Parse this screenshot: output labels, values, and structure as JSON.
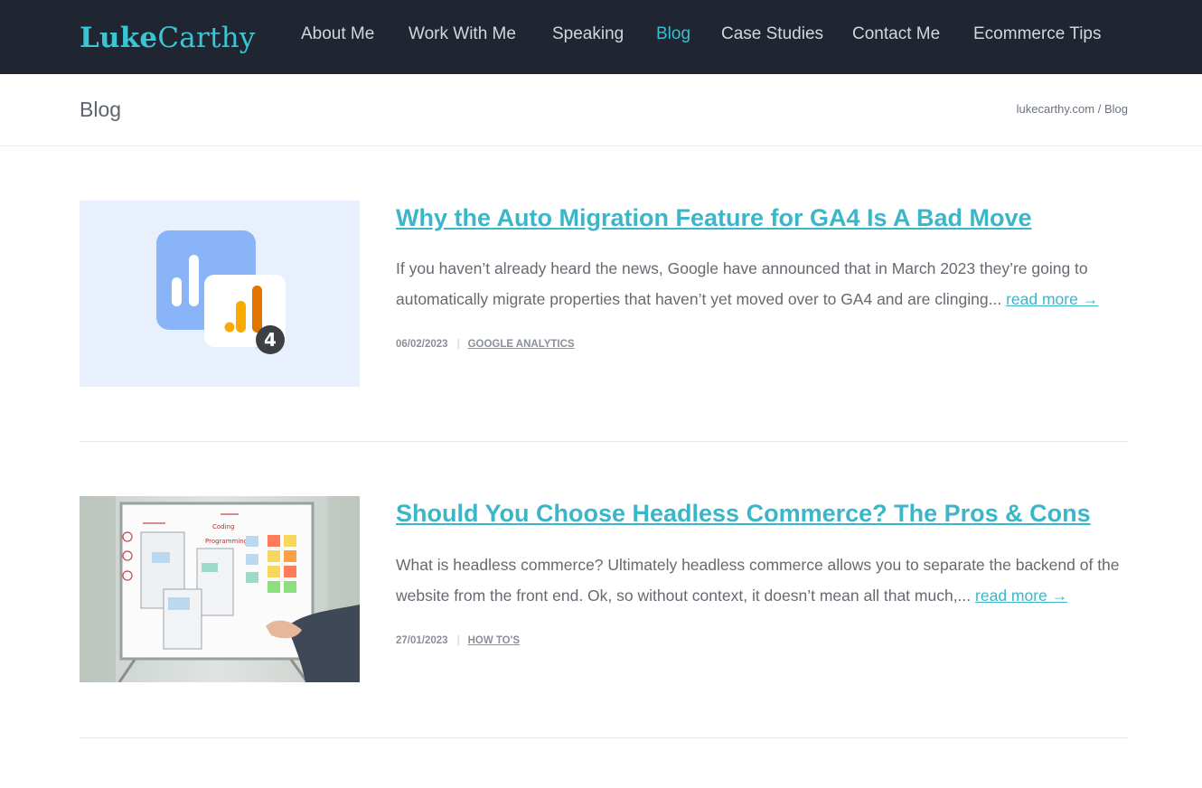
{
  "header": {
    "logo_part1": "Luke",
    "logo_part2": "Carthy",
    "nav": [
      {
        "label": "About Me"
      },
      {
        "label": "Work With Me"
      },
      {
        "label": "Speaking"
      },
      {
        "label": "Blog",
        "active": true
      },
      {
        "label": "Case Studies"
      },
      {
        "label": "Contact Me"
      },
      {
        "label": "Ecommerce Tips"
      }
    ]
  },
  "page": {
    "title": "Blog",
    "breadcrumb": {
      "home": "lukecarthy.com",
      "separator": "/",
      "current": "Blog"
    }
  },
  "posts": [
    {
      "title": "Why the Auto Migration Feature for GA4 Is A Bad Move",
      "excerpt": "If you haven’t already heard the news, Google have announced that in March 2023 they’re going to automatically migrate properties that haven’t yet moved over to GA4 and are clinging...",
      "read_more": "read more →",
      "date": "06/02/2023",
      "meta_separator": "|",
      "category": "GOOGLE ANALYTICS",
      "thumbnail_icon": "google-analytics-4-icon",
      "thumbnail_badge": "4"
    },
    {
      "title": "Should You Choose Headless Commerce? The Pros & Cons",
      "excerpt": "What is headless commerce? Ultimately headless commerce allows you to separate the backend of the website from the front end. Ok, so without context, it doesn’t mean all that much,...",
      "read_more": "read more →",
      "date": "27/01/2023",
      "meta_separator": "|",
      "category": "HOW TO'S",
      "thumbnail_icon": "whiteboard-photo",
      "whiteboard_notes": [
        "Coding",
        "Programming"
      ]
    }
  ],
  "colors": {
    "header_bg": "#1f2631",
    "accent": "#3bb6c8",
    "nav_text": "#d3d6db",
    "body_text": "#666a70"
  }
}
